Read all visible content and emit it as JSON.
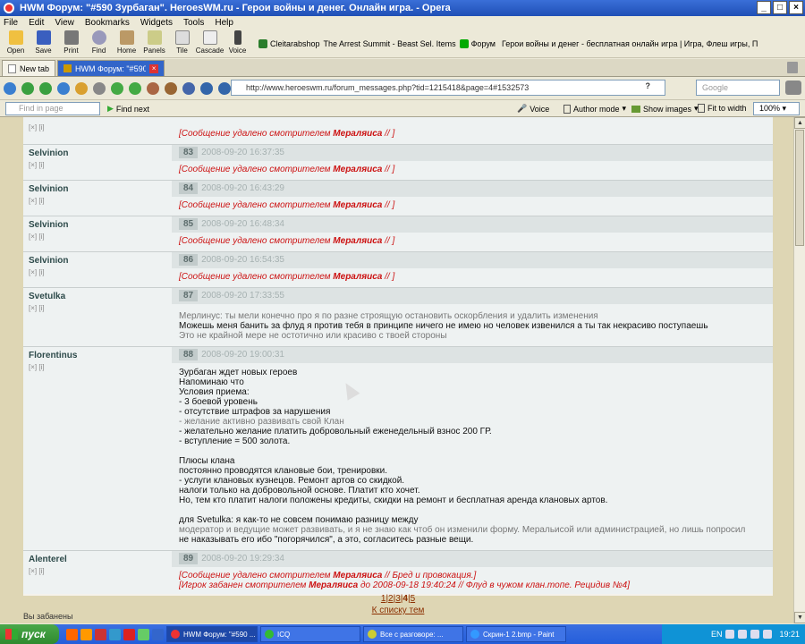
{
  "window": {
    "title": "HWM Форум: \"#590 Зурбаган\". HeroesWM.ru - Герои войны и денег. Онлайн игра. - Opera"
  },
  "menu": [
    "File",
    "Edit",
    "View",
    "Bookmarks",
    "Widgets",
    "Tools",
    "Help"
  ],
  "toolbar": {
    "buttons": [
      "Open",
      "Save",
      "Print",
      "Find",
      "Home",
      "Panels",
      "Tile",
      "Cascade",
      "Voice"
    ],
    "bookmarks": [
      "Cleitarabshop",
      "The Arrest Summit - Beast Sel. Items",
      "Форум",
      "Герои войны и денег - бесплатная онлайн игра | Игра, Флеш игры, Пвп игры!"
    ]
  },
  "tabs": [
    {
      "label": "New tab"
    },
    {
      "label": "HWM Форум: \"#590 Зур..."
    }
  ],
  "address": {
    "url": "http://www.heroeswm.ru/forum_messages.php?tid=1215418&page=4#1532573",
    "search_placeholder": "Google"
  },
  "findbar": {
    "find_placeholder": "Find in page",
    "find_next": "Find next",
    "voice": "Voice",
    "author_mode": "Author mode",
    "show_images": "Show images",
    "fit_to_width": "Fit to width",
    "zoom": "100%"
  },
  "deleted_prefix": "[Сообщение удалено смотрителем ",
  "moderator": "Мераляиса",
  "deleted_suffix": " // ]",
  "posts": [
    {
      "author": "",
      "bk": "",
      "num": "",
      "date": "",
      "deleted": true
    },
    {
      "author": "Selvinion",
      "bk": "[×] [i]",
      "num": "83",
      "date": "2008-09-20 16:37:35",
      "deleted": true
    },
    {
      "author": "Selvinion",
      "bk": "[×] [i]",
      "num": "84",
      "date": "2008-09-20 16:43:29",
      "deleted": true
    },
    {
      "author": "Selvinion",
      "bk": "[×] [i]",
      "num": "85",
      "date": "2008-09-20 16:48:34",
      "deleted": true
    },
    {
      "author": "Selvinion",
      "bk": "[×] [i]",
      "num": "86",
      "date": "2008-09-20 16:54:35",
      "deleted": true
    },
    {
      "author": "Svetulka",
      "bk": "[×] [i]",
      "num": "87",
      "date": "2008-09-20 17:33:55",
      "deleted": false,
      "lines": [
        "Мерлинус: ты мели конечно про я по разне строящую остановить оскорбления и удалить изменения",
        "Можешь меня банить за флуд я против тебя в принципе ничего не имею но человек извенился а ты так некрасиво поступаешь",
        "Это не крайной мере не остотично или красиво с твоей стороны"
      ]
    },
    {
      "author": "Florentinus",
      "bk": "[×] [i]",
      "num": "88",
      "date": "2008-09-20 19:00:31",
      "deleted": false,
      "lines": [
        "Зурбаган ждет новых героев",
        "Напоминаю что",
        "Условия приема:",
        "- 3 боевой уровень",
        "- отсутствие штрафов за нарушения",
        "- желание активно развивать свой Клан",
        "- желательно желание платить добровольный еженедельный взнос 200 ГР.",
        "- вступление = 500 золота.",
        "",
        "Плюсы клана",
        "   постоянно проводятся клановые бои, тренировки.",
        "- услуги клановых кузнецов. Ремонт артов со скидкой.",
        "   налоги только на добровольной основе. Платит кто хочет.",
        "Но, тем кто платит налоги положены кредиты, скидки на ремонт и бесплатная аренда клановых артов.",
        "",
        "для Svetulka: я как-то не совсем понимаю разницу между",
        "модератор и ведущие может развивать, и я не знаю как чтоб он изменили форму. Меральисой или администрацией, но лишь попросил",
        "не наказывать его ибо \"погорячился\", а это, согласитесь разные вещи."
      ]
    },
    {
      "author": "Alenterel",
      "bk": "[×] [i]",
      "num": "89",
      "date": "2008-09-20 19:29:34",
      "deleted": true,
      "extra_prefix": " // Бред и провокация.]",
      "ban": {
        "a": "[Игрок забанен смотрителем ",
        "b": " до 2008-09-18 19:40:24 // Флуд в чужом клан.топе. Рецидив №4]"
      }
    }
  ],
  "pagination": {
    "pages": [
      "1",
      "2",
      "3",
      "4",
      "5"
    ],
    "back": "К списку тем"
  },
  "banned_note": "Вы забанены",
  "taskbar": {
    "start": "пуск",
    "tasks": [
      "HWM Форум: \"#590 ...",
      "ICQ",
      "Все с разговоре: ...",
      "Скрин-1 2.bmp - Paint"
    ],
    "tray": {
      "lang": "EN",
      "clock": "19:21"
    }
  },
  "colors": {
    "deleted": "#cc1111",
    "link": "#8b2e00",
    "title_blue": "#1f4fb5"
  }
}
